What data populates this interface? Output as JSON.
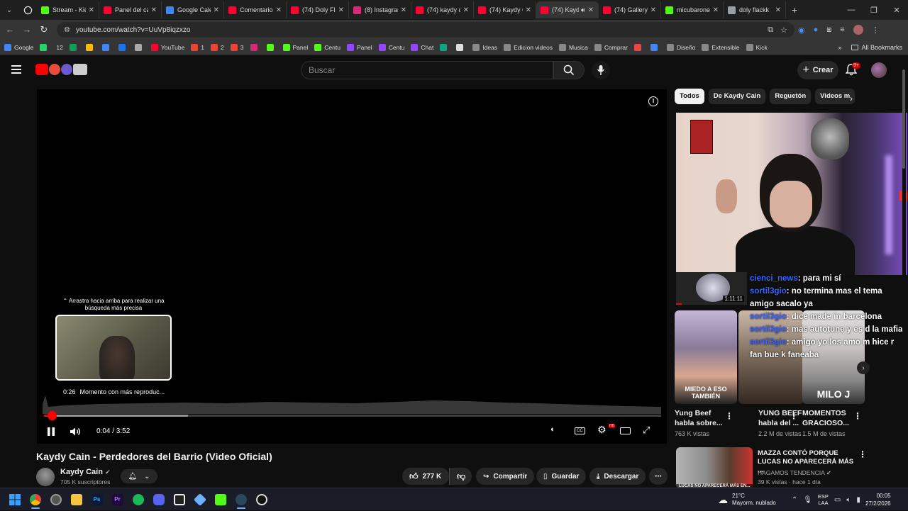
{
  "browser": {
    "tabs": [
      {
        "label": "Stream - Kick",
        "color": "#53fc18"
      },
      {
        "label": "Panel del canal",
        "color": "#ff0033"
      },
      {
        "label": "Google Calendar",
        "color": "#4285f4"
      },
      {
        "label": "Comentarios",
        "color": "#ff0033"
      },
      {
        "label": "(74) Doly Flackk",
        "color": "#ff0033"
      },
      {
        "label": "(8) Instagram",
        "color": "#d62976"
      },
      {
        "label": "(74) kaydy cain",
        "color": "#ff0033"
      },
      {
        "label": "(74) Kaydy Cain",
        "color": "#ff0033"
      },
      {
        "label": "(74) Kaydy Cain",
        "color": "#ff0033",
        "active": true
      },
      {
        "label": "(74) Gallery",
        "color": "#ff0033"
      },
      {
        "label": "micubaroneo",
        "color": "#53fc18"
      },
      {
        "label": "doly flackk",
        "color": "#9aa0a6"
      }
    ],
    "url": "youtube.com/watch?v=UuVp8iqzxzo",
    "bookmarks": [
      {
        "label": "Google",
        "color": "#4285f4"
      },
      {
        "label": "",
        "color": "#25d366"
      },
      {
        "label": "12",
        "color": ""
      },
      {
        "label": "",
        "color": "#0f9d58"
      },
      {
        "label": "",
        "color": "#fbbc04"
      },
      {
        "label": "",
        "color": "#4285f4"
      },
      {
        "label": "",
        "color": "#1a73e8"
      },
      {
        "label": "",
        "color": "#aaaaaa"
      },
      {
        "label": "YouTube",
        "color": "#ff0033"
      },
      {
        "label": "1",
        "color": "#ea4335"
      },
      {
        "label": "2",
        "color": "#ea4335"
      },
      {
        "label": "3",
        "color": "#ea4335"
      },
      {
        "label": "",
        "color": "#d62976"
      },
      {
        "label": "",
        "color": "#53fc18"
      },
      {
        "label": "Panel",
        "color": "#53fc18"
      },
      {
        "label": "Centu",
        "color": "#53fc18"
      },
      {
        "label": "Panel",
        "color": "#9146ff"
      },
      {
        "label": "Centu",
        "color": "#9146ff"
      },
      {
        "label": "Chat",
        "color": "#9146ff"
      },
      {
        "label": "",
        "color": "#10a37f"
      },
      {
        "label": "",
        "color": "#dddddd"
      },
      {
        "label": "Ideas",
        "color": "#888888"
      },
      {
        "label": "Edicion videos",
        "color": "#888888"
      },
      {
        "label": "Musica",
        "color": "#888888"
      },
      {
        "label": "Comprar",
        "color": "#888888"
      },
      {
        "label": "",
        "color": "#e44"
      },
      {
        "label": "",
        "color": "#4285f4"
      },
      {
        "label": "Diseño",
        "color": "#888888"
      },
      {
        "label": "Extensible",
        "color": "#888888"
      },
      {
        "label": "Kick",
        "color": "#888888"
      }
    ],
    "bookmarks_more": "»",
    "all_bookmarks": "All Bookmarks"
  },
  "youtube": {
    "search_placeholder": "Buscar",
    "create_label": "Crear",
    "notif_badge": "9+",
    "player": {
      "drag_hint": "Arrastra hacia arriba para realizar una búsqueda más precisa",
      "preview_time": "0:26",
      "preview_label": "Momento con más reproduc...",
      "time": "0:04 / 3:52",
      "progress_played": 0.017,
      "progress_buffered": 0.233
    },
    "video": {
      "title": "Kaydy Cain - Perdedores del Barrio (Video Oficial)",
      "channel": "Kaydy Cain",
      "subscribers": "705 K suscriptores",
      "likes": "277 K",
      "share": "Compartir",
      "save": "Guardar",
      "download": "Descargar"
    },
    "chips": [
      "Todos",
      "De Kaydy Cain",
      "Reguetón",
      "Videos m"
    ],
    "live_thumb_duration": "1:11:11",
    "chat": [
      {
        "user": "cienci_news",
        "text": ": para mi sí"
      },
      {
        "user": "sortil3gio",
        "text": ": no termina mas el tema amigo sacalo ya"
      },
      {
        "user": "sortil3gio",
        "text": ": dice made in barcelona"
      },
      {
        "user": "sortil3gio",
        "text": ": mas autotune y es d la mafia"
      },
      {
        "user": "sortil3gio",
        "text": ": amigo yo los amo m hice r fan bue k faneaba"
      }
    ],
    "shorts": [
      {
        "title": "Yung Beef habla sobre...",
        "views": "763 K vistas",
        "overlay": "MIEDO A ESO TAMBIÉN"
      },
      {
        "title": "YUNG BEEF habla del ...",
        "views": "2.2 M de vistas",
        "overlay": ""
      },
      {
        "title": "MOMENTOS GRACIOSO...",
        "views": "1.5 M de vistas",
        "overlay": "MILO J"
      }
    ],
    "next_video": {
      "title": "MAZZA CONTÓ PORQUE LUCAS NO APARECERÁ MÁS ...",
      "channel": "HAGAMOS TENDENCIA",
      "meta": "39 K vistas · hace 1 día",
      "thumb_caption": "LUCAS NO APARECERÁ MÁS EN..."
    }
  },
  "taskbar": {
    "weather_temp": "21°C",
    "weather_desc": "Mayorm. nublado",
    "lang_top": "ESP",
    "lang_bottom": "LAA",
    "time": "00:05",
    "date": "27/2/2026"
  }
}
